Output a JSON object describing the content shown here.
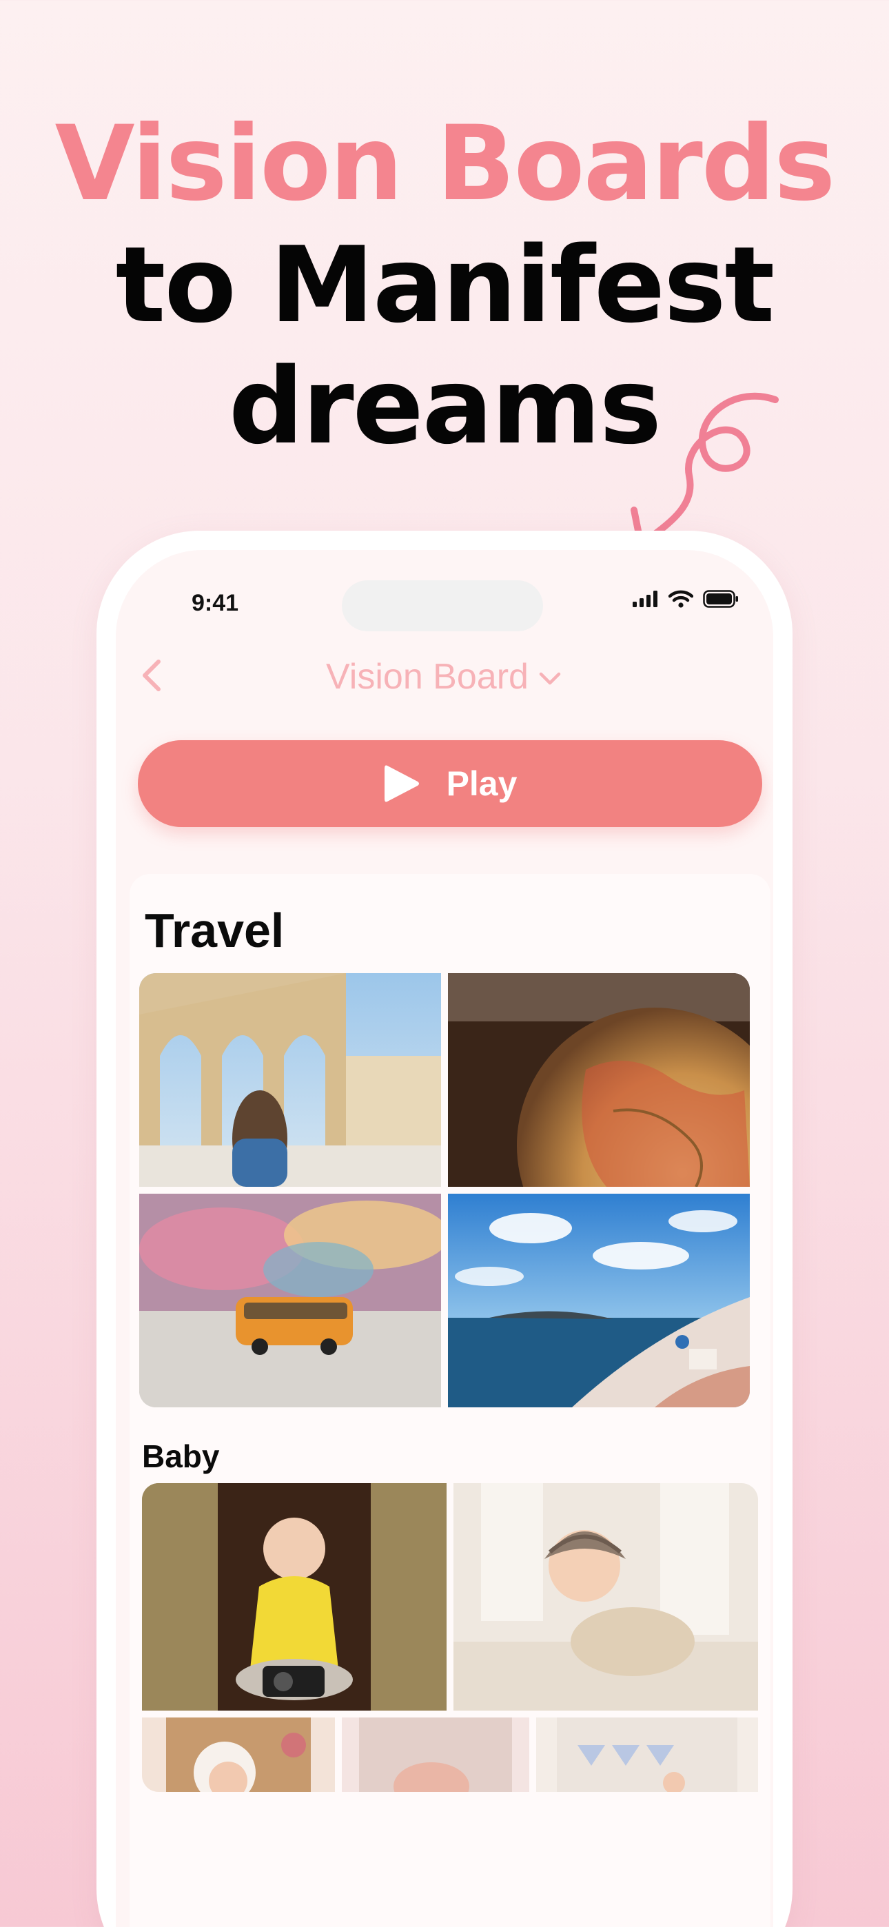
{
  "headline": {
    "line1": "Vision Boards",
    "line2": "to Manifest",
    "line3": "dreams"
  },
  "status_bar": {
    "time": "9:41",
    "icons": [
      "cellular-signal-icon",
      "wifi-icon",
      "battery-icon"
    ]
  },
  "navbar": {
    "back_icon": "chevron-left-icon",
    "title": "Vision Board",
    "dropdown_icon": "chevron-down-icon"
  },
  "play_button": {
    "label": "Play",
    "icon": "play-icon"
  },
  "sections": [
    {
      "title": "Travel",
      "photos": [
        "ancient-arches-photo",
        "globe-photo",
        "toy-bus-photo",
        "santorini-coast-photo"
      ]
    },
    {
      "title": "Baby",
      "photos": [
        "baby-with-camera-photo",
        "baby-in-hat-photo",
        "baby-in-bonnet-photo",
        "baby-feet-photo",
        "baby-standing-photo"
      ]
    }
  ],
  "colors": {
    "accent": "#f28281",
    "headline_pink": "#f4858f",
    "nav_title": "#f7b2b7"
  }
}
